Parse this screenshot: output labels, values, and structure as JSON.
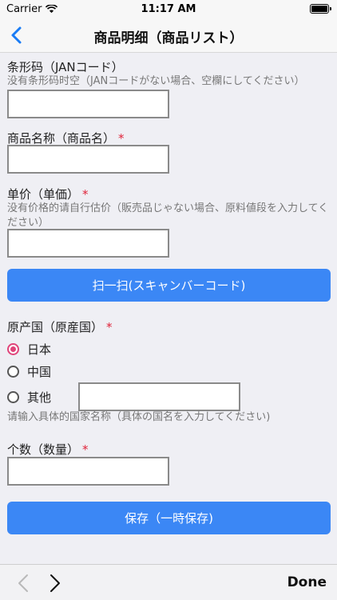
{
  "status_bar": {
    "carrier": "Carrier",
    "time": "11:17 AM"
  },
  "nav": {
    "title": "商品明细（商品リスト）"
  },
  "form": {
    "jan": {
      "label": "条形码（JANコード）",
      "hint": "没有条形码时空（JANコードがない場合、空欄にしてください）",
      "value": ""
    },
    "name": {
      "label": "商品名称（商品名）",
      "required": "*",
      "value": ""
    },
    "price": {
      "label": "单价（单価）",
      "required": "*",
      "hint": "没有价格的请自行估价（販売品じゃない場合、原料値段を入力してください）",
      "value": ""
    },
    "scan_button": "扫一扫(スキャンバーコード)",
    "origin": {
      "label": "原产国（原産国）",
      "required": "*",
      "options": [
        "日本",
        "中国",
        "其他"
      ],
      "selected": "日本",
      "other_value": "",
      "other_hint": "请输入具体的国家名称（具体の国名を入力してください)"
    },
    "quantity": {
      "label": "个数（数量）",
      "required": "*",
      "value": ""
    },
    "save_button": "保存（一時保存)"
  },
  "toolbar": {
    "done_label": "Done"
  },
  "colors": {
    "accent": "#3b87f5",
    "radio_checked": "#e0447a",
    "required": "#e0243a"
  }
}
